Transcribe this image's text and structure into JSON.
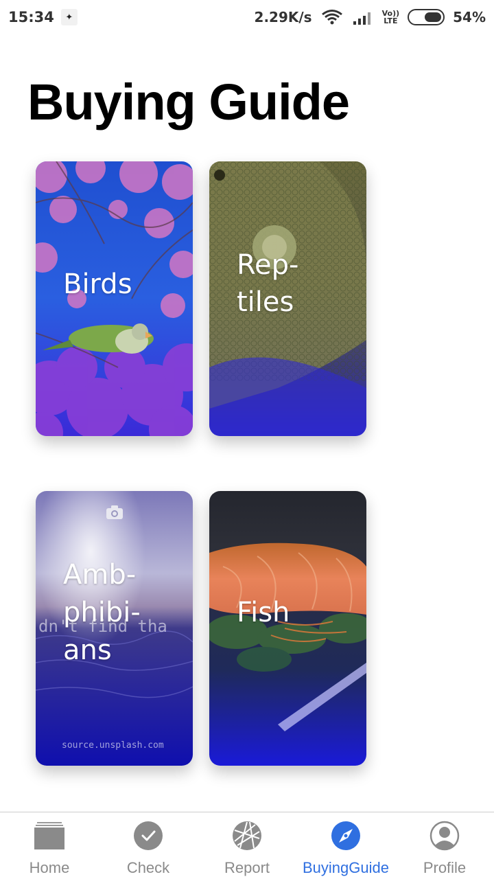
{
  "status_bar": {
    "time": "15:34",
    "net_speed": "2.29K/s",
    "volte_line1": "Vo))",
    "volte_line2": "LTE",
    "battery_percent": "54%",
    "battery_level": 0.54
  },
  "page": {
    "title": "Buying Guide"
  },
  "cards": [
    {
      "label": "Birds"
    },
    {
      "label_line1": "Rep-",
      "label_line2": "tiles"
    },
    {
      "label_line1": "Amb-",
      "label_line2": "phibi-",
      "label_line3": "ans",
      "placeholder_text": "dn't find tha",
      "source": "source.unsplash.com"
    },
    {
      "label": "Fish"
    }
  ],
  "bottom_nav": {
    "items": [
      {
        "label": "Home",
        "icon": "home-icon"
      },
      {
        "label": "Check",
        "icon": "check-icon"
      },
      {
        "label": "Report",
        "icon": "report-icon"
      },
      {
        "label": "BuyingGuide",
        "icon": "compass-icon",
        "active": true
      },
      {
        "label": "Profile",
        "icon": "profile-icon"
      }
    ]
  },
  "colors": {
    "accent": "#2f6fe0",
    "nav_inactive": "#8a8a8a",
    "card_overlay": "#2a1fd8"
  }
}
